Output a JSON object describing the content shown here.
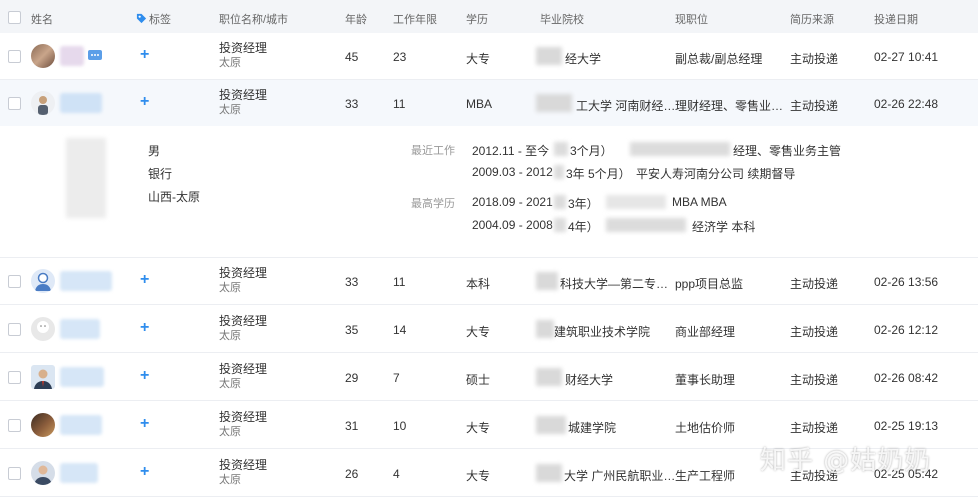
{
  "columns": {
    "name": "姓名",
    "tags": "标签",
    "position": "职位名称/城市",
    "age": "年龄",
    "years": "工作年限",
    "education": "学历",
    "school": "毕业院校",
    "current_position": "现职位",
    "source": "简历来源",
    "date": "投递日期"
  },
  "rows": [
    {
      "position": "投资经理",
      "city": "太原",
      "age": "45",
      "years": "23",
      "education": "大专",
      "school": "经大学",
      "current_position": "副总裁/副总经理",
      "source": "主动投递",
      "date": "02-27 10:41"
    },
    {
      "position": "投资经理",
      "city": "太原",
      "age": "33",
      "years": "11",
      "education": "MBA",
      "school": "工大学 河南财经…",
      "current_position": "理财经理、零售业…",
      "source": "主动投递",
      "date": "02-26 22:48"
    },
    {
      "position": "投资经理",
      "city": "太原",
      "age": "33",
      "years": "11",
      "education": "本科",
      "school": "科技大学—第二专…",
      "current_position": "ppp项目总监",
      "source": "主动投递",
      "date": "02-26 13:56"
    },
    {
      "position": "投资经理",
      "city": "太原",
      "age": "35",
      "years": "14",
      "education": "大专",
      "school": "建筑职业技术学院",
      "current_position": "商业部经理",
      "source": "主动投递",
      "date": "02-26 12:12"
    },
    {
      "position": "投资经理",
      "city": "太原",
      "age": "29",
      "years": "7",
      "education": "硕士",
      "school": "财经大学",
      "current_position": "董事长助理",
      "source": "主动投递",
      "date": "02-26 08:42"
    },
    {
      "position": "投资经理",
      "city": "太原",
      "age": "31",
      "years": "10",
      "education": "大专",
      "school": "城建学院",
      "current_position": "土地估价师",
      "source": "主动投递",
      "date": "02-25 19:13"
    },
    {
      "position": "投资经理",
      "city": "太原",
      "age": "26",
      "years": "4",
      "education": "大专",
      "school": "大学 广州民航职业…",
      "current_position": "生产工程师",
      "source": "主动投递",
      "date": "02-25 05:42"
    }
  ],
  "detail": {
    "gender": "男",
    "industry": "银行",
    "location": "山西-太原",
    "recent_work_label": "最近工作",
    "work1": "2012.11 - 至今",
    "work1_dur": "3个月）",
    "work1_title": "经理、零售业务主管",
    "work2": "2009.03 - 2012",
    "work2_dur": "3年 5个月）",
    "work2_company": "平安人寿河南分公司 续期督导",
    "edu_label": "最高学历",
    "edu1": "2018.09 - 2021",
    "edu1_dur": "3年）",
    "edu1_degree": "MBA MBA",
    "edu2": "2004.09 - 2008",
    "edu2_dur": "4年）",
    "edu2_major": "经济学 本科"
  },
  "watermark": "知乎 @姑奶奶",
  "colors": {
    "accent": "#2f8ded",
    "header_bg": "#f3f5f8",
    "row_border": "#eceef2"
  }
}
